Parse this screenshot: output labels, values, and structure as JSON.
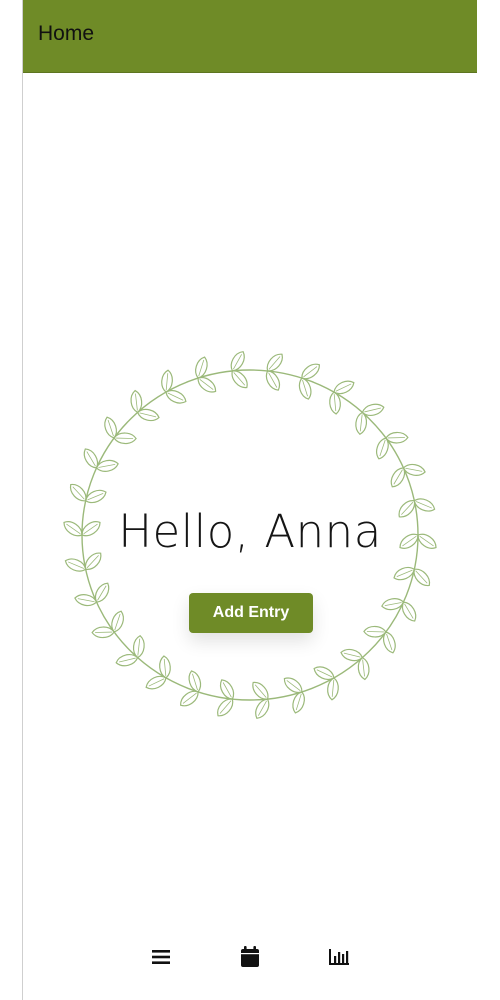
{
  "header": {
    "title": "Home",
    "background_color": "#6f8b27"
  },
  "main": {
    "greeting": "Hello, Anna",
    "add_entry_label": "Add Entry",
    "decoration_icon": "leaf-wreath-icon",
    "decoration_color": "#9bb97a"
  },
  "bottom_nav": {
    "items": [
      {
        "icon": "menu-icon"
      },
      {
        "icon": "calendar-icon"
      },
      {
        "icon": "bar-chart-icon"
      }
    ]
  }
}
